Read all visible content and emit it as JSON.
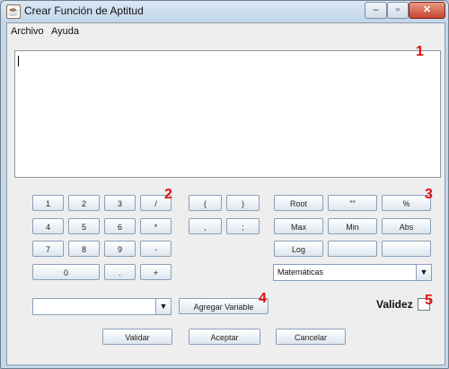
{
  "window": {
    "title": "Crear Función de Aptitud"
  },
  "menu": {
    "archivo": "Archivo",
    "ayuda": "Ayuda"
  },
  "keypad": {
    "k1": "1",
    "k2": "2",
    "k3": "3",
    "div": "/",
    "k4": "4",
    "k5": "5",
    "k6": "6",
    "mul": "*",
    "k7": "7",
    "k8": "8",
    "k9": "9",
    "sub": "-",
    "k0": "0",
    "dot": ".",
    "add": "+"
  },
  "symbols": {
    "lparen": "(",
    "rparen": ")",
    "comma": ",",
    "semicolon": ";"
  },
  "functions": {
    "root": "Root",
    "quote": "\"\"",
    "percent": "%",
    "max": "Max",
    "min": "Min",
    "abs": "Abs",
    "log": "Log",
    "blank1": "",
    "blank2": ""
  },
  "category_select": {
    "value": "Matemáticas"
  },
  "variable_select": {
    "value": ""
  },
  "buttons": {
    "agregar_variable": "Agregar Variable",
    "validar": "Validar",
    "aceptar": "Aceptar",
    "cancelar": "Cancelar"
  },
  "validez_label": "Validez",
  "annotations": {
    "a1": "1",
    "a2": "2",
    "a3": "3",
    "a4": "4",
    "a5": "5"
  },
  "colors": {
    "annotation": "#e01010",
    "button_border": "#8aa0b8"
  }
}
